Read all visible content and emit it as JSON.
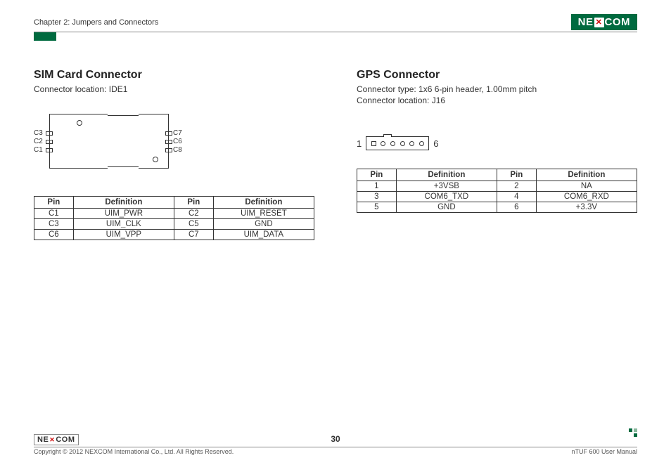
{
  "header": {
    "chapter": "Chapter 2: Jumpers and Connectors",
    "logo_pre": "NE",
    "logo_x": "✕",
    "logo_post": "COM"
  },
  "sim": {
    "title": "SIM Card Connector",
    "location": "Connector location: IDE1",
    "labels": {
      "c1": "C1",
      "c2": "C2",
      "c3": "C3",
      "c6": "C6",
      "c7": "C7",
      "c8": "C8"
    },
    "th": {
      "pin": "Pin",
      "def": "Definition"
    },
    "rows": [
      {
        "p1": "C1",
        "d1": "UIM_PWR",
        "p2": "C2",
        "d2": "UIM_RESET"
      },
      {
        "p1": "C3",
        "d1": "UIM_CLK",
        "p2": "C5",
        "d2": "GND"
      },
      {
        "p1": "C6",
        "d1": "UIM_VPP",
        "p2": "C7",
        "d2": "UIM_DATA"
      }
    ]
  },
  "gps": {
    "title": "GPS Connector",
    "type": "Connector type: 1x6 6-pin header, 1.00mm pitch",
    "location": "Connector location: J16",
    "left": "1",
    "right": "6",
    "th": {
      "pin": "Pin",
      "def": "Definition"
    },
    "rows": [
      {
        "p1": "1",
        "d1": "+3VSB",
        "p2": "2",
        "d2": "NA"
      },
      {
        "p1": "3",
        "d1": "COM6_TXD",
        "p2": "4",
        "d2": "COM6_RXD"
      },
      {
        "p1": "5",
        "d1": "GND",
        "p2": "6",
        "d2": "+3.3V"
      }
    ]
  },
  "footer": {
    "copyright": "Copyright © 2012 NEXCOM International Co., Ltd. All Rights Reserved.",
    "page": "30",
    "manual": "nTUF 600 User Manual"
  }
}
